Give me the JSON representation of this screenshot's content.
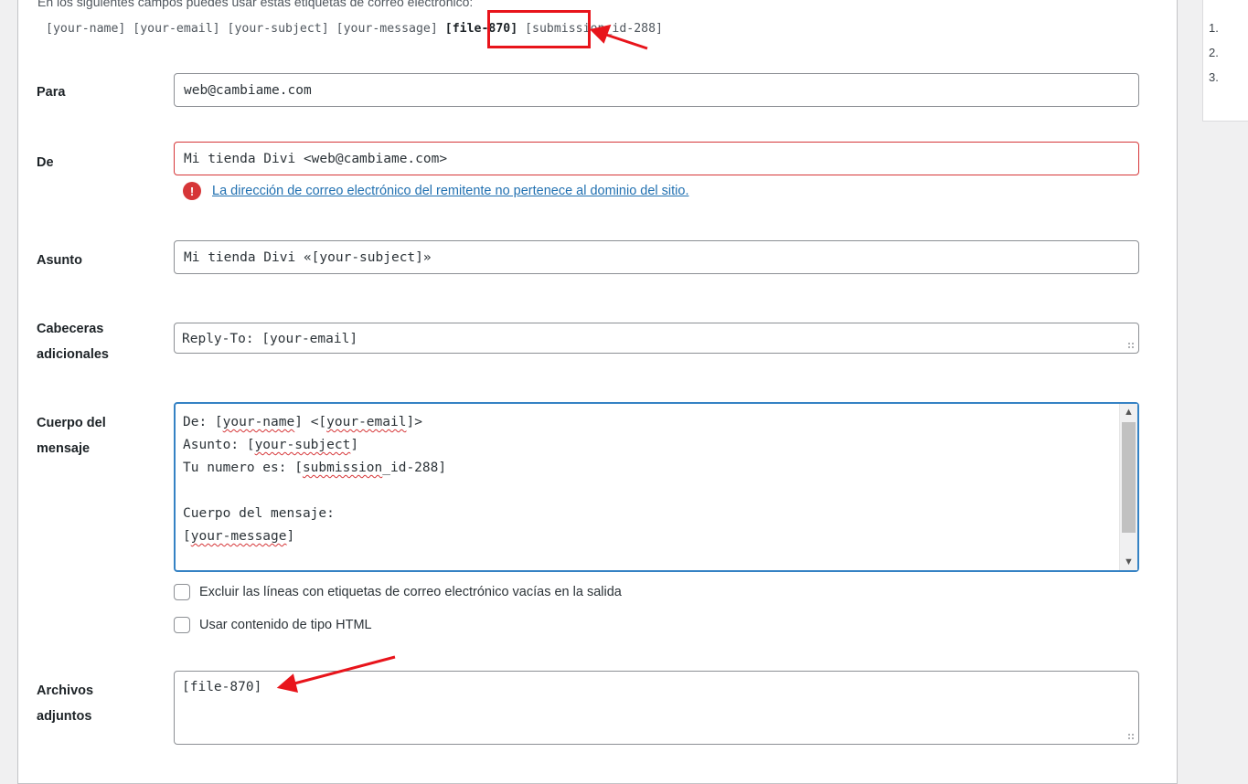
{
  "mail": {
    "hint": "En los siguientes campos puedes usar estas etiquetas de correo electrónico:",
    "tags": [
      "[your-name]",
      "[your-email]",
      "[your-subject]",
      "[your-message]",
      "[file-870]",
      "[submission_id-288]"
    ],
    "to": {
      "label": "Para",
      "value": "web@cambiame.com"
    },
    "from": {
      "label": "De",
      "value": "Mi tienda Divi <web@cambiame.com>",
      "error": "La dirección de correo electrónico del remitente no pertenece al dominio del sitio."
    },
    "subject": {
      "label": "Asunto",
      "value": "Mi tienda Divi «[your-subject]»"
    },
    "headers": {
      "label_1": "Cabeceras",
      "label_2": "adicionales",
      "value": "Reply-To: [your-email]"
    },
    "body": {
      "label_1": "Cuerpo del",
      "label_2": "mensaje",
      "line1_a": "De: [",
      "line1_b": "your-name",
      "line1_c": "] <[",
      "line1_d": "your-email",
      "line1_e": "]>",
      "line2_a": "Asunto: [",
      "line2_b": "your-subject",
      "line2_c": "]",
      "line3_a": "Tu numero es: [",
      "line3_b": "submission",
      "line3_c": "_id-288]",
      "line4": "",
      "line5": "Cuerpo del mensaje:",
      "line6_a": "[",
      "line6_b": "your-message",
      "line6_c": "]"
    },
    "exclude_blank": "Excluir las líneas con etiquetas de correo electrónico vacías en la salida",
    "use_html": "Usar contenido de tipo HTML",
    "attachments": {
      "label_1": "Archivos",
      "label_2": "adjuntos",
      "value": "[file-870]"
    }
  },
  "sidebar": {
    "items": [
      "1.",
      "2.",
      "3."
    ]
  },
  "colors": {
    "error": "#d63638",
    "link": "#2271b1",
    "annotation": "#e8141b",
    "focus": "#3582c4"
  }
}
